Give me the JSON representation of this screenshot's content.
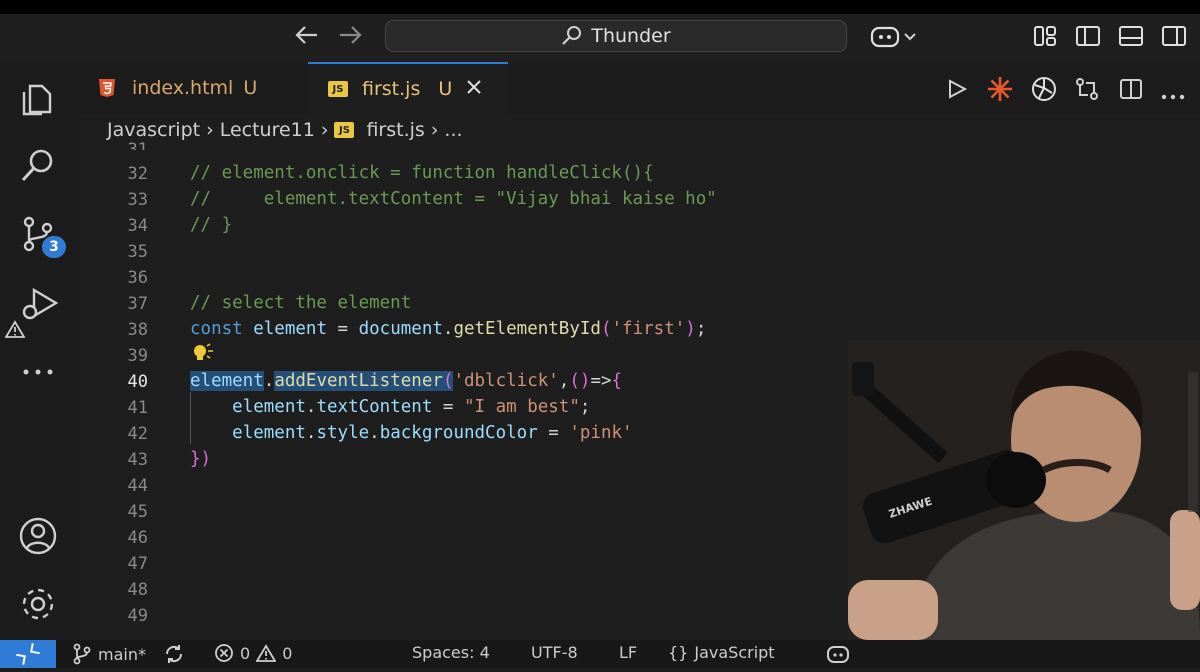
{
  "titlebar": {
    "search_text": "Thunder",
    "back_icon": "arrow-left-icon",
    "forward_icon": "arrow-right-icon",
    "copilot_icon": "copilot-icon"
  },
  "activity_bar": {
    "items": [
      "explorer-icon",
      "search-icon",
      "source-control-icon",
      "run-debug-icon",
      "more-icon"
    ],
    "source_control_badge": "3",
    "bottom_items": [
      "account-icon",
      "settings-icon"
    ]
  },
  "tabs": [
    {
      "name": "index.html",
      "status": "U",
      "icon": "html5-icon",
      "active": false
    },
    {
      "name": "first.js",
      "status": "U",
      "icon": "js-icon",
      "active": true
    }
  ],
  "breadcrumb": {
    "folder": "Javascript",
    "subfolder": "Lecture11",
    "file": "first.js",
    "more": "..."
  },
  "editor": {
    "current_line": "40",
    "partial_top_line": "31",
    "lines": [
      {
        "num": "32",
        "text": "// element.onclick = function handleClick(){"
      },
      {
        "num": "33",
        "text": "//     element.textContent = \"Vijay bhai kaise ho\""
      },
      {
        "num": "34",
        "text": "// }"
      },
      {
        "num": "35",
        "text": ""
      },
      {
        "num": "36",
        "text": ""
      },
      {
        "num": "37",
        "text": "// select the element"
      },
      {
        "num": "38",
        "text": "const element = document.getElementById('first');"
      },
      {
        "num": "39",
        "text": ""
      },
      {
        "num": "40",
        "text": "element.addEventListener('dblclick',()=>{"
      },
      {
        "num": "41",
        "text": "    element.textContent = \"I am best\";"
      },
      {
        "num": "42",
        "text": "    element.style.backgroundColor = 'pink'"
      },
      {
        "num": "43",
        "text": "})"
      },
      {
        "num": "44",
        "text": ""
      },
      {
        "num": "45",
        "text": ""
      },
      {
        "num": "46",
        "text": ""
      },
      {
        "num": "47",
        "text": ""
      },
      {
        "num": "48",
        "text": ""
      },
      {
        "num": "49",
        "text": ""
      }
    ]
  },
  "statusbar": {
    "branch": "main*",
    "errors": "0",
    "warnings": "0",
    "spaces": "Spaces: 4",
    "encoding": "UTF-8",
    "eol": "LF",
    "language": "JavaScript"
  },
  "colors": {
    "accent": "#2f7bd6",
    "comment": "#6a9955",
    "keyword": "#569cd6",
    "string": "#ce9178"
  }
}
